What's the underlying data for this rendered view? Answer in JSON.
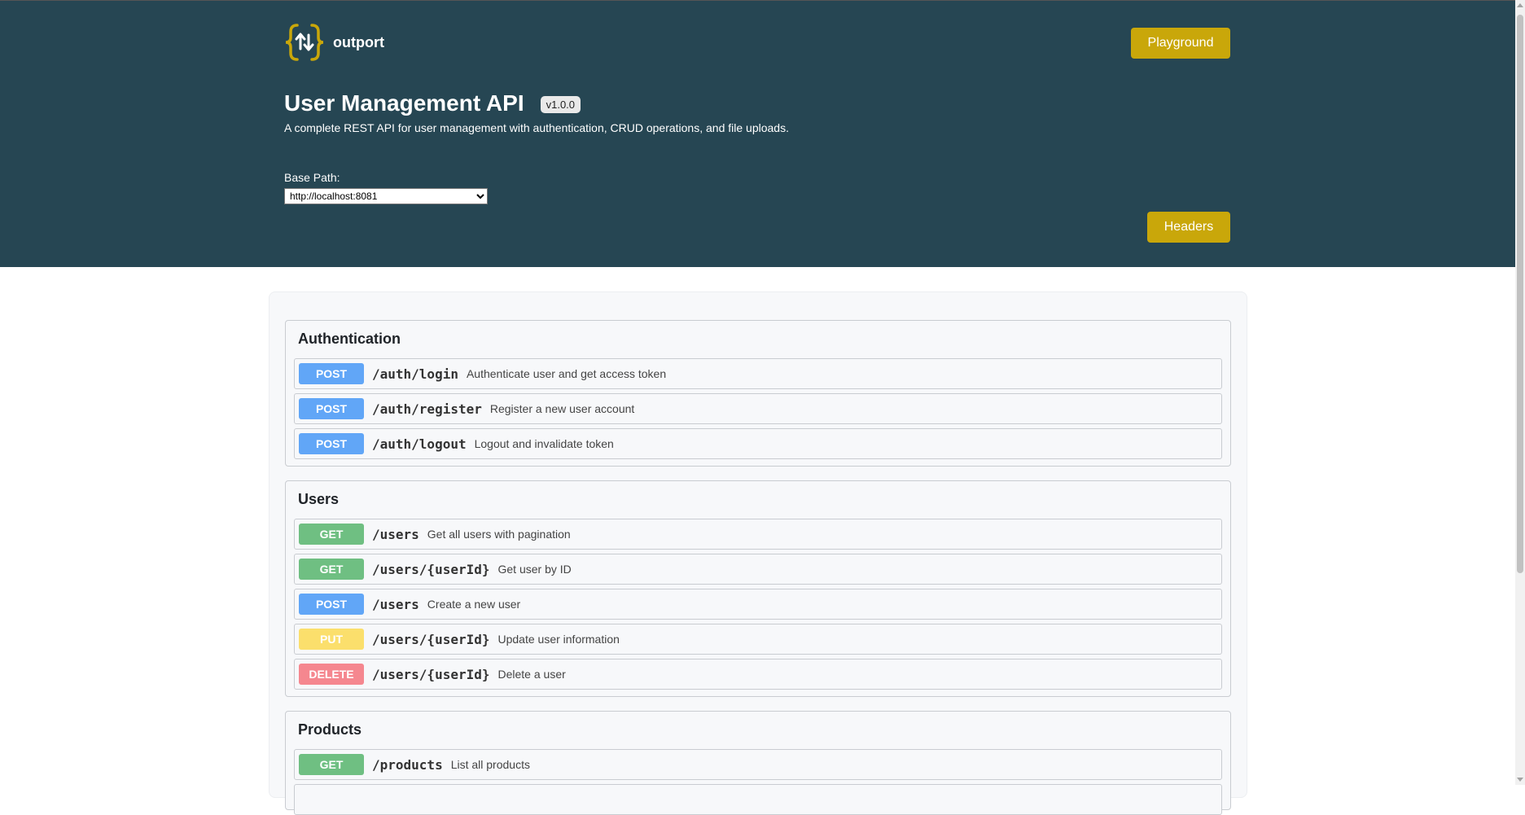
{
  "brand": {
    "name": "outport",
    "logo_icon": "braces-arrows-icon",
    "accent": "#c9a70a"
  },
  "header": {
    "playground_label": "Playground",
    "headers_label": "Headers",
    "title": "User Management API",
    "version": "v1.0.0",
    "description": "A complete REST API for user management with authentication, CRUD operations, and file uploads.",
    "base_path_label": "Base Path:",
    "base_path_value": "http://localhost:8081",
    "background": "#264653"
  },
  "groups": [
    {
      "title": "Authentication",
      "endpoints": [
        {
          "method": "POST",
          "path": "/auth/login",
          "summary": "Authenticate user and get access token"
        },
        {
          "method": "POST",
          "path": "/auth/register",
          "summary": "Register a new user account"
        },
        {
          "method": "POST",
          "path": "/auth/logout",
          "summary": "Logout and invalidate token"
        }
      ]
    },
    {
      "title": "Users",
      "endpoints": [
        {
          "method": "GET",
          "path": "/users",
          "summary": "Get all users with pagination"
        },
        {
          "method": "GET",
          "path": "/users/{userId}",
          "summary": "Get user by ID"
        },
        {
          "method": "POST",
          "path": "/users",
          "summary": "Create a new user"
        },
        {
          "method": "PUT",
          "path": "/users/{userId}",
          "summary": "Update user information"
        },
        {
          "method": "DELETE",
          "path": "/users/{userId}",
          "summary": "Delete a user"
        }
      ]
    },
    {
      "title": "Products",
      "endpoints": [
        {
          "method": "GET",
          "path": "/products",
          "summary": "List all products"
        }
      ]
    }
  ],
  "method_colors": {
    "POST": "#61a6f7",
    "GET": "#6fbf82",
    "PUT": "#fbdf6c",
    "DELETE": "#f5878f"
  }
}
